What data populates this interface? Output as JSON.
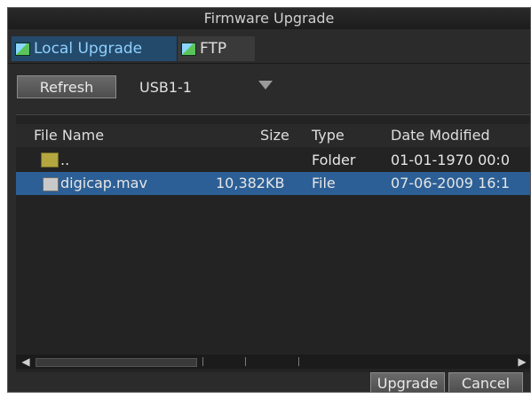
{
  "window": {
    "title": "Firmware Upgrade"
  },
  "tabs": [
    {
      "label": "Local Upgrade",
      "icon": "network-drive-icon",
      "active": true
    },
    {
      "label": "FTP",
      "icon": "network-drive-icon",
      "active": false
    }
  ],
  "toolbar": {
    "refresh_label": "Refresh",
    "drive_value": "USB1-1"
  },
  "filelist": {
    "columns": [
      "File Name",
      "Size",
      "Type",
      "Date Modified"
    ],
    "rows": [
      {
        "name": "..",
        "size": "",
        "type": "Folder",
        "date": "01-01-1970 00:0",
        "icon": "folder-icon",
        "selected": false
      },
      {
        "name": "digicap.mav",
        "size": "10,382KB",
        "type": "File",
        "date": "07-06-2009 16:1",
        "icon": "file-icon",
        "selected": true
      }
    ]
  },
  "footer": {
    "upgrade_label": "Upgrade",
    "cancel_label": "Cancel"
  },
  "colors": {
    "background": "#2b2b2b",
    "selection": "#2c5f95",
    "active_tab": "#244a6b"
  }
}
